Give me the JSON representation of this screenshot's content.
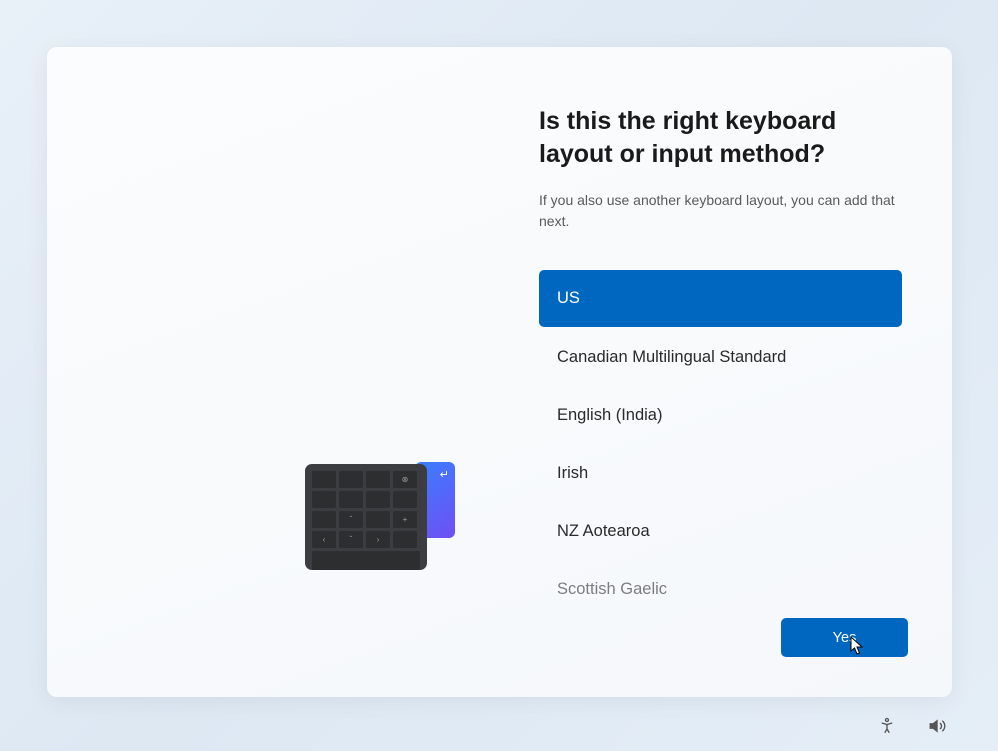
{
  "title": "Is this the right keyboard layout or input method?",
  "subtitle": "If you also use another keyboard layout, you can add that next.",
  "layouts": [
    {
      "label": "US",
      "selected": true
    },
    {
      "label": "Canadian Multilingual Standard",
      "selected": false
    },
    {
      "label": "English (India)",
      "selected": false
    },
    {
      "label": "Irish",
      "selected": false
    },
    {
      "label": "NZ Aotearoa",
      "selected": false
    },
    {
      "label": "Scottish Gaelic",
      "selected": false
    }
  ],
  "yes_button": "Yes"
}
